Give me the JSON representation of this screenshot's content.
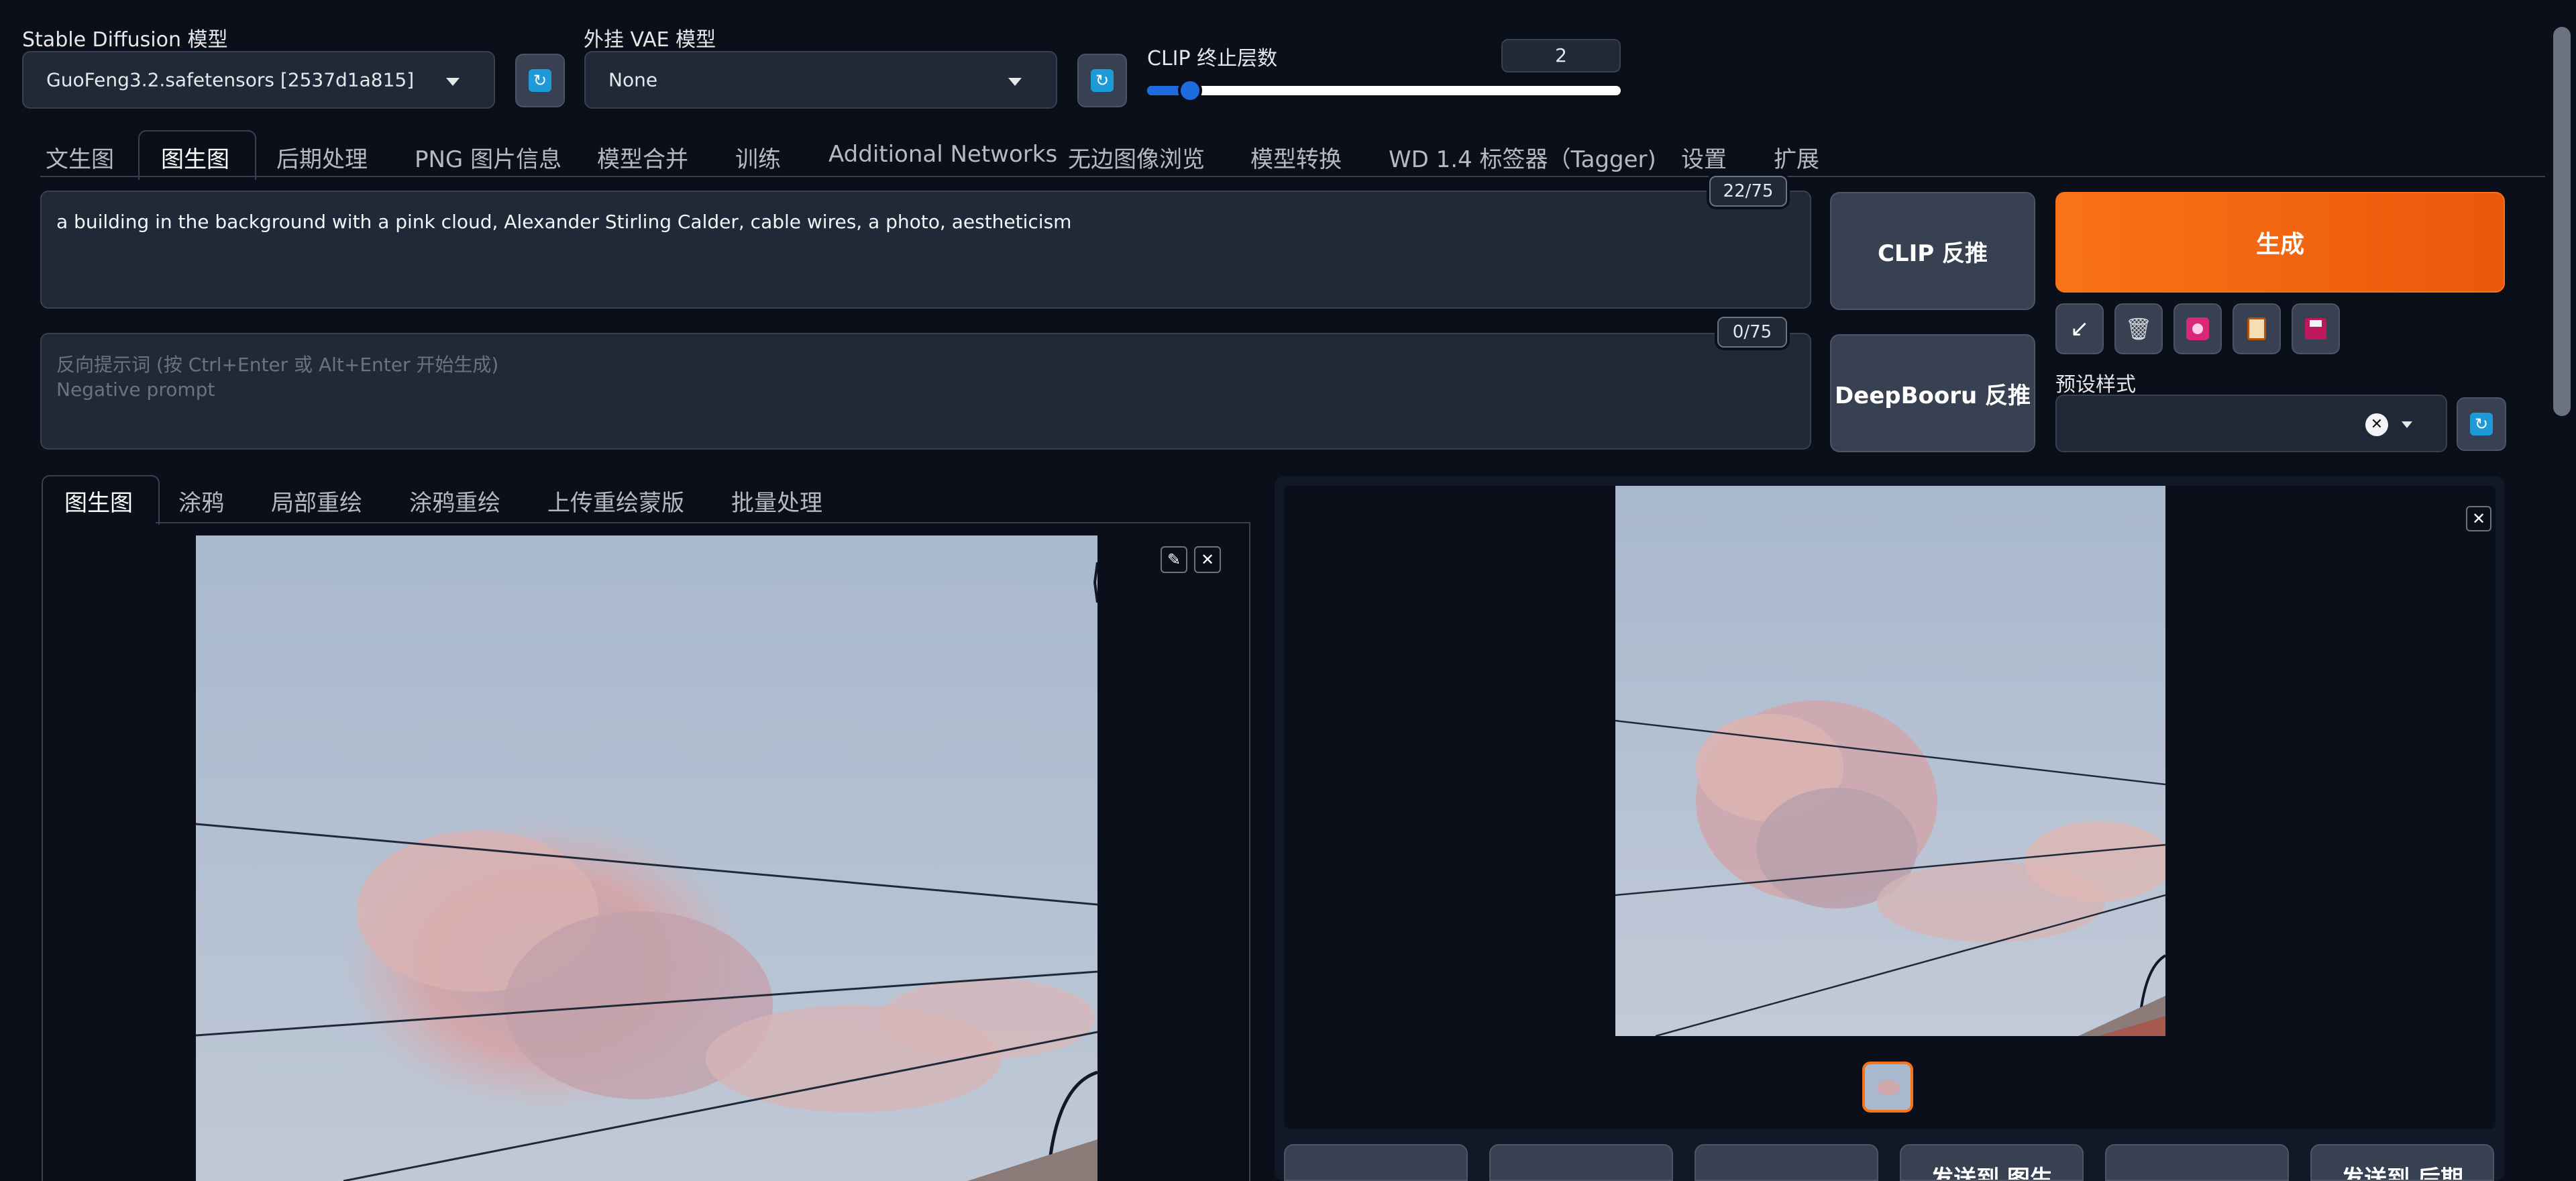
{
  "top": {
    "sd_model_label": "Stable Diffusion 模型",
    "sd_model_value": "GuoFeng3.2.safetensors [2537d1a815]",
    "vae_label": "外挂 VAE 模型",
    "vae_value": "None",
    "clip_label": "CLIP 终止层数",
    "clip_value": "2",
    "clip_slider_fraction": 0.09
  },
  "main_tabs": [
    {
      "label": "文生图"
    },
    {
      "label": "图生图"
    },
    {
      "label": "后期处理"
    },
    {
      "label": "PNG 图片信息"
    },
    {
      "label": "模型合并"
    },
    {
      "label": "训练"
    },
    {
      "label": "Additional Networks"
    },
    {
      "label": "无边图像浏览"
    },
    {
      "label": "模型转换"
    },
    {
      "label": "WD 1.4 标签器（Tagger)"
    },
    {
      "label": "设置"
    },
    {
      "label": "扩展"
    }
  ],
  "prompt": {
    "text": "a building in the background with a pink cloud, Alexander Stirling Calder, cable wires, a photo, aestheticism",
    "counter": "22/75"
  },
  "negative": {
    "placeholder_line1": "反向提示词 (按 Ctrl+Enter 或 Alt+Enter 开始生成)",
    "placeholder_line2": "Negative prompt",
    "counter": "0/75"
  },
  "buttons": {
    "clip_interrogate": "CLIP 反推",
    "deepbooru": "DeepBooru 反推",
    "generate": "生成",
    "tool_icons": [
      "arrow-icon",
      "trash-icon",
      "image-icon",
      "clipboard-icon",
      "save-icon"
    ]
  },
  "styles": {
    "label": "预设样式"
  },
  "sub_tabs": [
    {
      "label": "图生图"
    },
    {
      "label": "涂鸦"
    },
    {
      "label": "局部重绘"
    },
    {
      "label": "涂鸦重绘"
    },
    {
      "label": "上传重绘蒙版"
    },
    {
      "label": "批量处理"
    }
  ],
  "output_buttons": [
    {
      "label": ""
    },
    {
      "label": ""
    },
    {
      "label": ""
    },
    {
      "label": "发送到 图生"
    },
    {
      "label": ""
    },
    {
      "label": "发送到 后期"
    }
  ],
  "colors": {
    "background": "#0b0f19",
    "generate_start": "#f97316",
    "generate_end": "#ea580c",
    "accent_blue": "#1e9ad6"
  }
}
